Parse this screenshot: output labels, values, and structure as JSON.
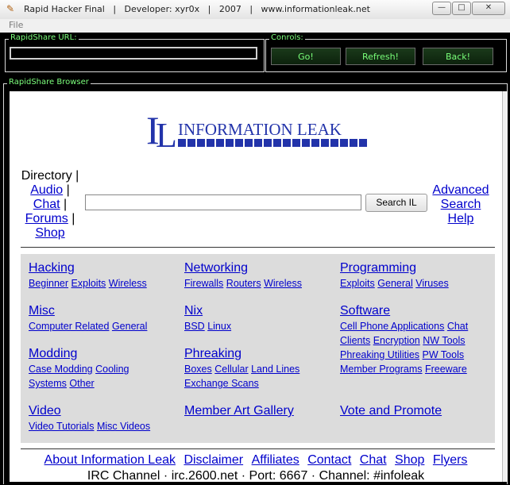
{
  "window": {
    "title": "Rapid Hacker Final   |   Developer: xyr0x   |   2007   |   www.informationleak.net",
    "buttons": {
      "minimize": "—",
      "maximize": "□",
      "close": "✕"
    }
  },
  "menu": {
    "file": "File"
  },
  "url_group": {
    "label": "RapidShare URL:",
    "value": ""
  },
  "controls_group": {
    "label": "Conrols:",
    "go": "Go!",
    "refresh": "Refresh!",
    "back": "Back!"
  },
  "browser_group": {
    "label": "RapidShare Browser"
  },
  "site": {
    "logo_text": "INFORMATION LEAK",
    "directory_label": "Directory",
    "dir_links": [
      "Audio",
      "Chat",
      "Forums",
      "Shop"
    ],
    "search_button": "Search IL",
    "search_placeholder": "",
    "advanced": "Advanced",
    "search": "Search",
    "help": "Help",
    "categories": [
      {
        "title": "Hacking",
        "subs": [
          "Beginner",
          "Exploits",
          "Wireless"
        ]
      },
      {
        "title": "Networking",
        "subs": [
          "Firewalls",
          "Routers",
          "Wireless"
        ]
      },
      {
        "title": "Programming",
        "subs": [
          "Exploits",
          "General",
          "Viruses"
        ]
      },
      {
        "title": "Misc",
        "subs": [
          "Computer Related",
          "General"
        ]
      },
      {
        "title": "Nix",
        "subs": [
          "BSD",
          "Linux"
        ]
      },
      {
        "title": "Software",
        "subs": [
          "Cell Phone Applications",
          "Chat Clients",
          "Encryption",
          "NW Tools",
          "Phreaking Utilities",
          "PW Tools",
          "Member Programs",
          "Freeware"
        ]
      },
      {
        "title": "Modding",
        "subs": [
          "Case Modding",
          "Cooling Systems",
          "Other"
        ]
      },
      {
        "title": "Phreaking",
        "subs": [
          "Boxes",
          "Cellular",
          "Land Lines",
          "Exchange Scans"
        ]
      },
      {
        "title": "Video",
        "subs": [
          "Video Tutorials",
          "Misc Videos"
        ]
      },
      {
        "title": "Member Art Gallery",
        "subs": []
      },
      {
        "title": "Vote and Promote",
        "subs": []
      }
    ],
    "footer_links": [
      "About Information Leak",
      "Disclaimer",
      "Affiliates",
      "Contact",
      "Chat",
      "Shop",
      "Flyers"
    ],
    "irc_line": "IRC Channel · irc.2600.net · Port: 6667 · Channel: #infoleak"
  },
  "colors": {
    "accent_green": "#7cff7c",
    "link_blue": "#0000cc",
    "logo_blue": "#2233aa"
  }
}
